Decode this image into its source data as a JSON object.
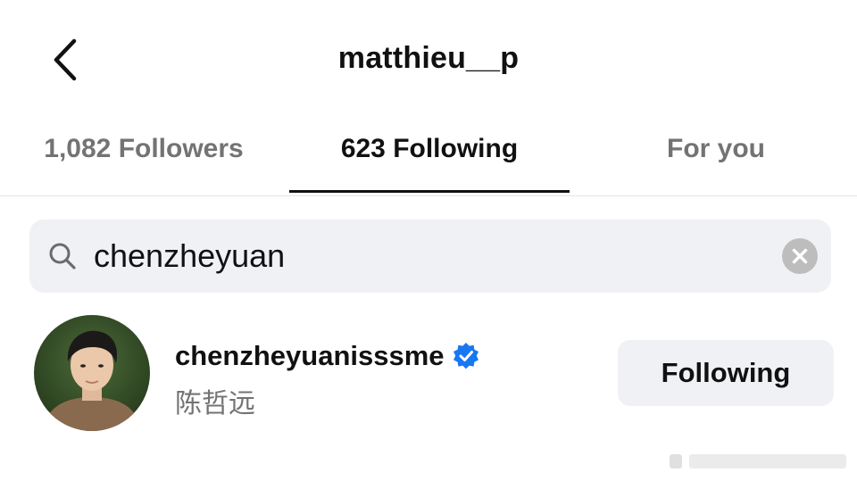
{
  "header": {
    "title": "matthieu__p",
    "back_icon": "chevron-left-icon"
  },
  "tabs": [
    {
      "label": "1,082 Followers",
      "active": false
    },
    {
      "label": "623 Following",
      "active": true
    },
    {
      "label": "For you",
      "active": false
    }
  ],
  "search": {
    "icon": "search-icon",
    "value": "chenzheyuan",
    "clear_icon": "clear-icon"
  },
  "result": {
    "username": "chenzheyuanisssme",
    "verified": true,
    "full_name": "陈哲远",
    "button_label": "Following"
  },
  "colors": {
    "text_primary": "#111111",
    "text_secondary": "#737373",
    "pill_background": "#eff1f5",
    "verified_blue": "#1877f2",
    "clear_gray": "#bdbdbd"
  }
}
